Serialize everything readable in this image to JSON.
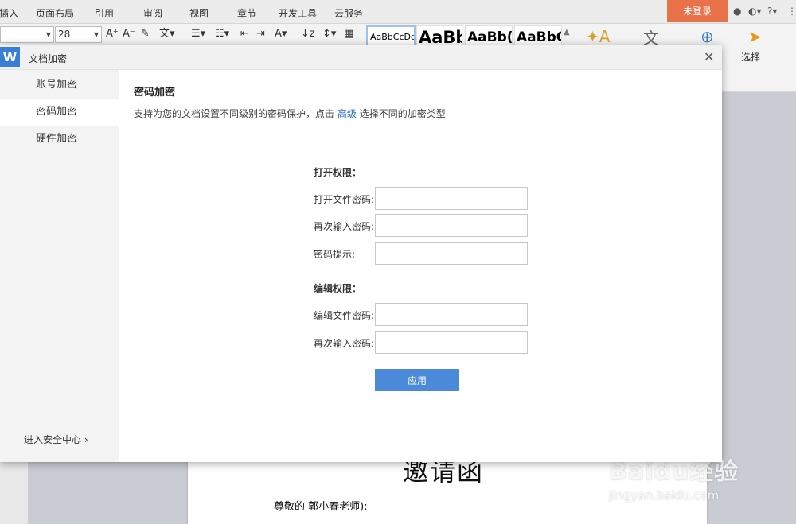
{
  "menubar": {
    "items": [
      "插入",
      "页面布局",
      "引用",
      "审阅",
      "视图",
      "章节",
      "开发工具",
      "云服务"
    ],
    "login_label": "未登录"
  },
  "ribbon": {
    "font_size": "28",
    "styles": [
      "AaBbCcDd",
      "AaBb",
      "AaBb(",
      "AaBbC"
    ],
    "select_label": "选择"
  },
  "document": {
    "title": "邀请函",
    "greeting": "尊敬的   郭小春老师):"
  },
  "watermark": {
    "main": "Baidu经验",
    "sub": "jingyan.baidu.com"
  },
  "dialog": {
    "title": "文档加密",
    "sidebar": {
      "items": [
        {
          "label": "账号加密"
        },
        {
          "label": "密码加密"
        },
        {
          "label": "硬件加密"
        }
      ],
      "footer": "进入安全中心"
    },
    "main": {
      "section_title": "密码加密",
      "desc_prefix": "支持为您的文档设置不同级别的密码保护，点击",
      "desc_link": "高级",
      "desc_suffix": "选择不同的加密类型",
      "open_group": "打开权限：",
      "open_password_label": "打开文件密码:",
      "open_confirm_label": "再次输入密码:",
      "hint_label": "密码提示:",
      "edit_group": "编辑权限：",
      "edit_password_label": "编辑文件密码:",
      "edit_confirm_label": "再次输入密码:",
      "apply_label": "应用"
    }
  },
  "colors": {
    "accent": "#4a8ad8",
    "login": "#e8714a",
    "link": "#2a6ecb"
  }
}
